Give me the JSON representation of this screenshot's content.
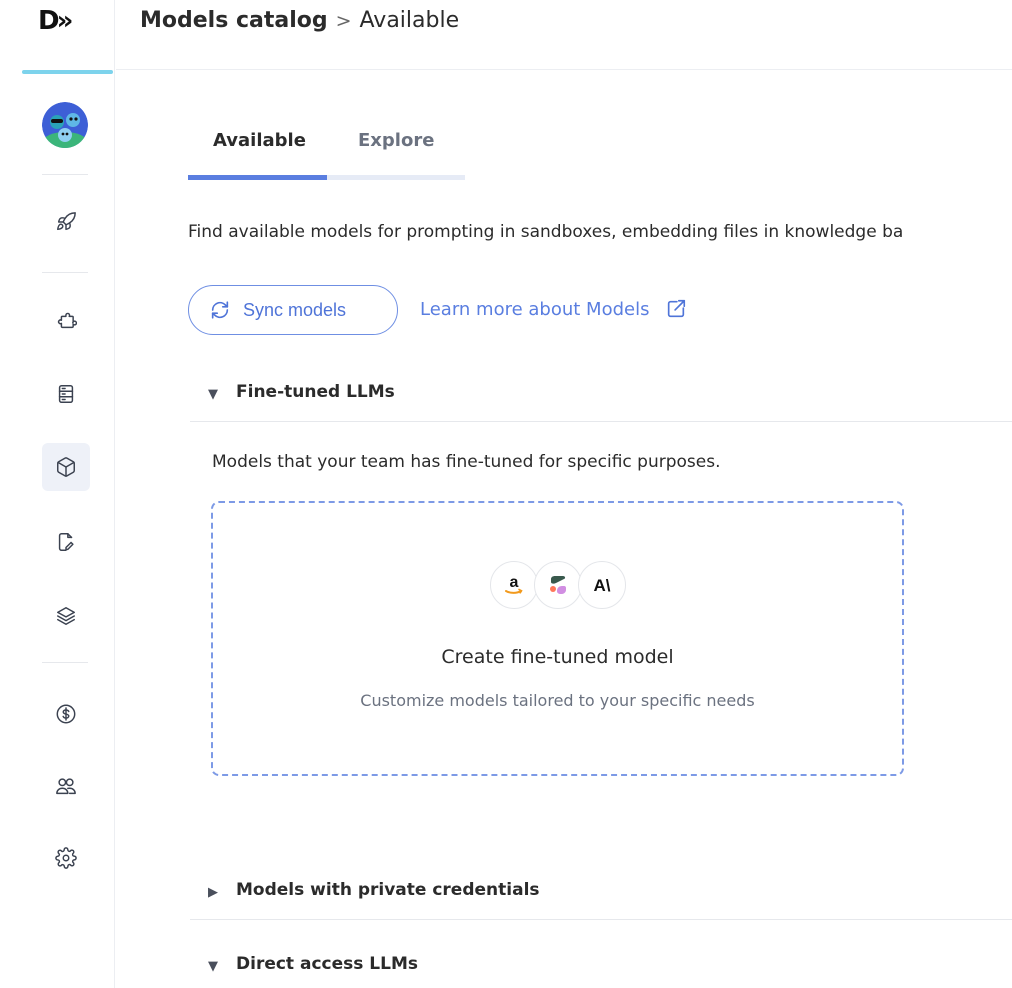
{
  "sidebar": {
    "logo_text": "D»",
    "nav_items": [
      {
        "name": "rocket-icon",
        "label": "Getting started"
      },
      {
        "name": "puzzle-icon",
        "label": "Integrations"
      },
      {
        "name": "server-icon",
        "label": "Knowledge bases"
      },
      {
        "name": "cube-icon",
        "label": "Models catalog",
        "active": true
      },
      {
        "name": "edit-document-icon",
        "label": "Sandboxes"
      },
      {
        "name": "layers-icon",
        "label": "Stacks"
      },
      {
        "name": "dollar-icon",
        "label": "Billing"
      },
      {
        "name": "users-icon",
        "label": "Team"
      },
      {
        "name": "gear-icon",
        "label": "Settings"
      }
    ],
    "accent_color": "#7dd3ec"
  },
  "header": {
    "breadcrumb_root": "Models catalog",
    "breadcrumb_separator": ">",
    "breadcrumb_current": "Available"
  },
  "tabs": {
    "items": [
      {
        "label": "Available",
        "active": true
      },
      {
        "label": "Explore",
        "active": false
      }
    ]
  },
  "main": {
    "description": "Find available models for prompting in sandboxes, embedding files in knowledge ba",
    "sync_button_label": "Sync models",
    "learn_more_label": "Learn more about Models"
  },
  "sections": {
    "fine_tuned": {
      "title": "Fine-tuned LLMs",
      "expanded": true,
      "description": "Models that your team has fine-tuned for specific purposes.",
      "card": {
        "title": "Create fine-tuned model",
        "subtitle": "Customize models tailored to your specific needs",
        "providers": [
          {
            "name": "amazon-logo-icon",
            "glyph": "a"
          },
          {
            "name": "cohere-logo-icon"
          },
          {
            "name": "anthropic-logo-icon",
            "glyph": "A\\"
          }
        ]
      }
    },
    "private_credentials": {
      "title": "Models with private credentials",
      "expanded": false
    },
    "direct_access": {
      "title": "Direct access LLMs",
      "expanded": true
    }
  },
  "colors": {
    "primary": "#5a7ee0",
    "tab_track": "#e6ebf6",
    "card_border": "#7d9ae6"
  }
}
